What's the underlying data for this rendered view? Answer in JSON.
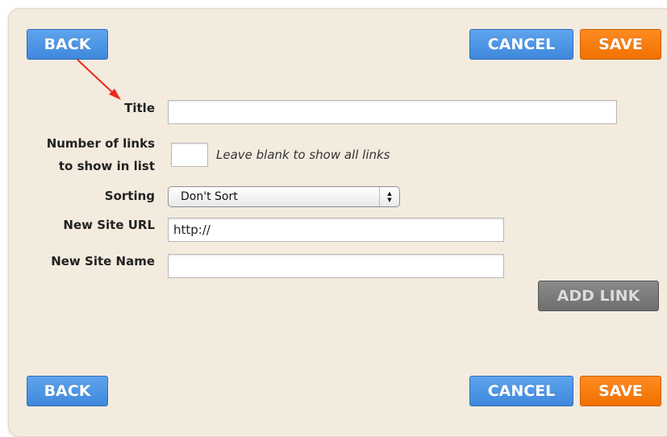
{
  "buttons": {
    "back": "BACK",
    "cancel": "CANCEL",
    "save": "SAVE",
    "add_link": "ADD LINK"
  },
  "form": {
    "title_label": "Title",
    "title_value": "",
    "num_links_label_line1": "Number of links",
    "num_links_label_line2": "to show in list",
    "num_links_value": "",
    "num_links_hint": "Leave blank to show all links",
    "sorting_label": "Sorting",
    "sorting_selected": "Don't Sort",
    "new_site_url_label": "New Site URL",
    "new_site_url_value": "http://",
    "new_site_name_label": "New Site Name",
    "new_site_name_value": ""
  },
  "colors": {
    "panel_bg": "#f4ebdf",
    "blue_button": "#4a94e6",
    "orange_button": "#f47a0d",
    "gray_button": "#777777",
    "annotation_arrow": "#e8281e"
  },
  "icons": {
    "select_arrows": "updown-chevron-icon",
    "annotation": "red-arrow-icon"
  }
}
